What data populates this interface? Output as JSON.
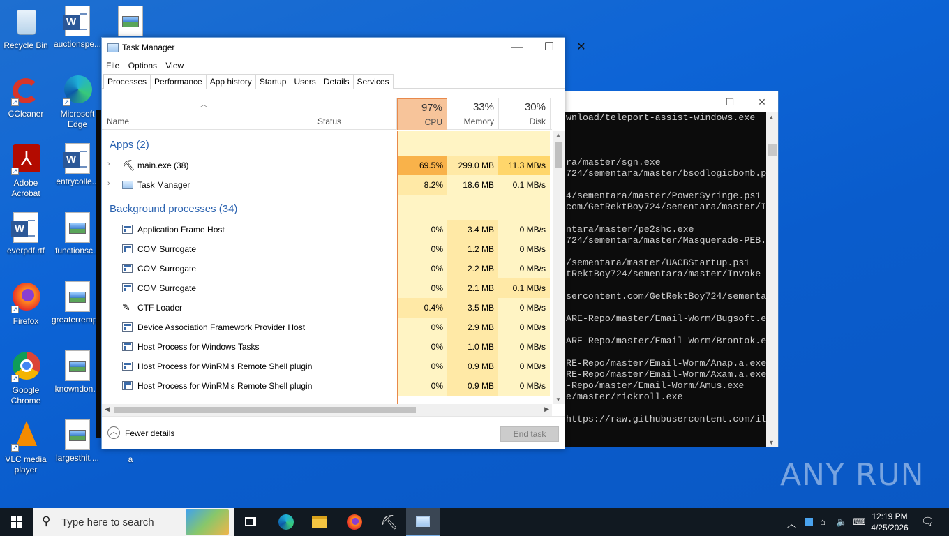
{
  "desktop": {
    "icons": [
      {
        "label": "Recycle Bin"
      },
      {
        "label": "auctionspe..."
      },
      {
        "label": "CCleaner"
      },
      {
        "label": "Microsoft Edge"
      },
      {
        "label": "Adobe Acrobat"
      },
      {
        "label": "entrycolle..."
      },
      {
        "label": "everpdf.rtf"
      },
      {
        "label": "functionsc..."
      },
      {
        "label": "Firefox"
      },
      {
        "label": "greaterremp..."
      },
      {
        "label": "Google Chrome"
      },
      {
        "label": "knowndon..."
      },
      {
        "label": "VLC media player"
      },
      {
        "label": "largesthit...."
      },
      {
        "label": "a"
      }
    ]
  },
  "cmd": {
    "lines": [
      "wnload/teleport-assist-windows.exe",
      "",
      "",
      "",
      "ra/master/sgn.exe",
      "724/sementara/master/bsodlogicbomb.ps",
      "",
      "4/sementara/master/PowerSyringe.ps1",
      "com/GetRektBoy724/sementara/master/I",
      "",
      "ntara/master/pe2shc.exe",
      "724/sementara/master/Masquerade-PEB.",
      "",
      "/sementara/master/UACBStartup.ps1",
      "tRektBoy724/sementara/master/Invoke-",
      "",
      "sercontent.com/GetRektBoy724/sementa",
      "",
      "ARE-Repo/master/Email-Worm/Bugsoft.e",
      "",
      "ARE-Repo/master/Email-Worm/Brontok.e",
      "",
      "RE-Repo/master/Email-Worm/Anap.a.exe",
      "RE-Repo/master/Email-Worm/Axam.a.exe",
      "-Repo/master/Email-Worm/Amus.exe",
      "e/master/rickroll.exe",
      "",
      "https://raw.githubusercontent.com/il"
    ]
  },
  "taskmgr": {
    "title": "Task Manager",
    "menu": [
      "File",
      "Options",
      "View"
    ],
    "tabs": [
      "Processes",
      "Performance",
      "App history",
      "Startup",
      "Users",
      "Details",
      "Services"
    ],
    "columns": {
      "name": "Name",
      "status": "Status",
      "cpu_pct": "97%",
      "cpu": "CPU",
      "mem_pct": "33%",
      "mem": "Memory",
      "disk_pct": "30%",
      "disk": "Disk"
    },
    "apps_group": "Apps (2)",
    "apps": [
      {
        "name": "main.exe (38)",
        "cpu": "69.5%",
        "mem": "299.0 MB",
        "disk": "11.3 MB/s"
      },
      {
        "name": "Task Manager",
        "cpu": "8.2%",
        "mem": "18.6 MB",
        "disk": "0.1 MB/s"
      }
    ],
    "bg_group": "Background processes (34)",
    "background": [
      {
        "name": "Application Frame Host",
        "cpu": "0%",
        "mem": "3.4 MB",
        "disk": "0 MB/s"
      },
      {
        "name": "COM Surrogate",
        "cpu": "0%",
        "mem": "1.2 MB",
        "disk": "0 MB/s"
      },
      {
        "name": "COM Surrogate",
        "cpu": "0%",
        "mem": "2.2 MB",
        "disk": "0 MB/s"
      },
      {
        "name": "COM Surrogate",
        "cpu": "0%",
        "mem": "2.1 MB",
        "disk": "0.1 MB/s"
      },
      {
        "name": "CTF Loader",
        "cpu": "0.4%",
        "mem": "3.5 MB",
        "disk": "0 MB/s"
      },
      {
        "name": "Device Association Framework Provider Host",
        "cpu": "0%",
        "mem": "2.9 MB",
        "disk": "0 MB/s"
      },
      {
        "name": "Host Process for Windows Tasks",
        "cpu": "0%",
        "mem": "1.0 MB",
        "disk": "0 MB/s"
      },
      {
        "name": "Host Process for WinRM's Remote Shell plugin",
        "cpu": "0%",
        "mem": "0.9 MB",
        "disk": "0 MB/s"
      },
      {
        "name": "Host Process for WinRM's Remote Shell plugin",
        "cpu": "0%",
        "mem": "0.9 MB",
        "disk": "0 MB/s"
      }
    ],
    "fewer_details": "Fewer details",
    "end_task": "End task"
  },
  "watermark": "ANY RUN",
  "taskbar": {
    "search_placeholder": "Type here to search",
    "time": "12:19 PM",
    "date": "4/25/2026"
  },
  "colors": {
    "cpu_header_bg": "#f7c49a",
    "cpu_high": "#f9b24a",
    "cell_light": "#fff4c4",
    "cell_mid": "#ffe9a6",
    "group_text": "#2a62b0"
  }
}
